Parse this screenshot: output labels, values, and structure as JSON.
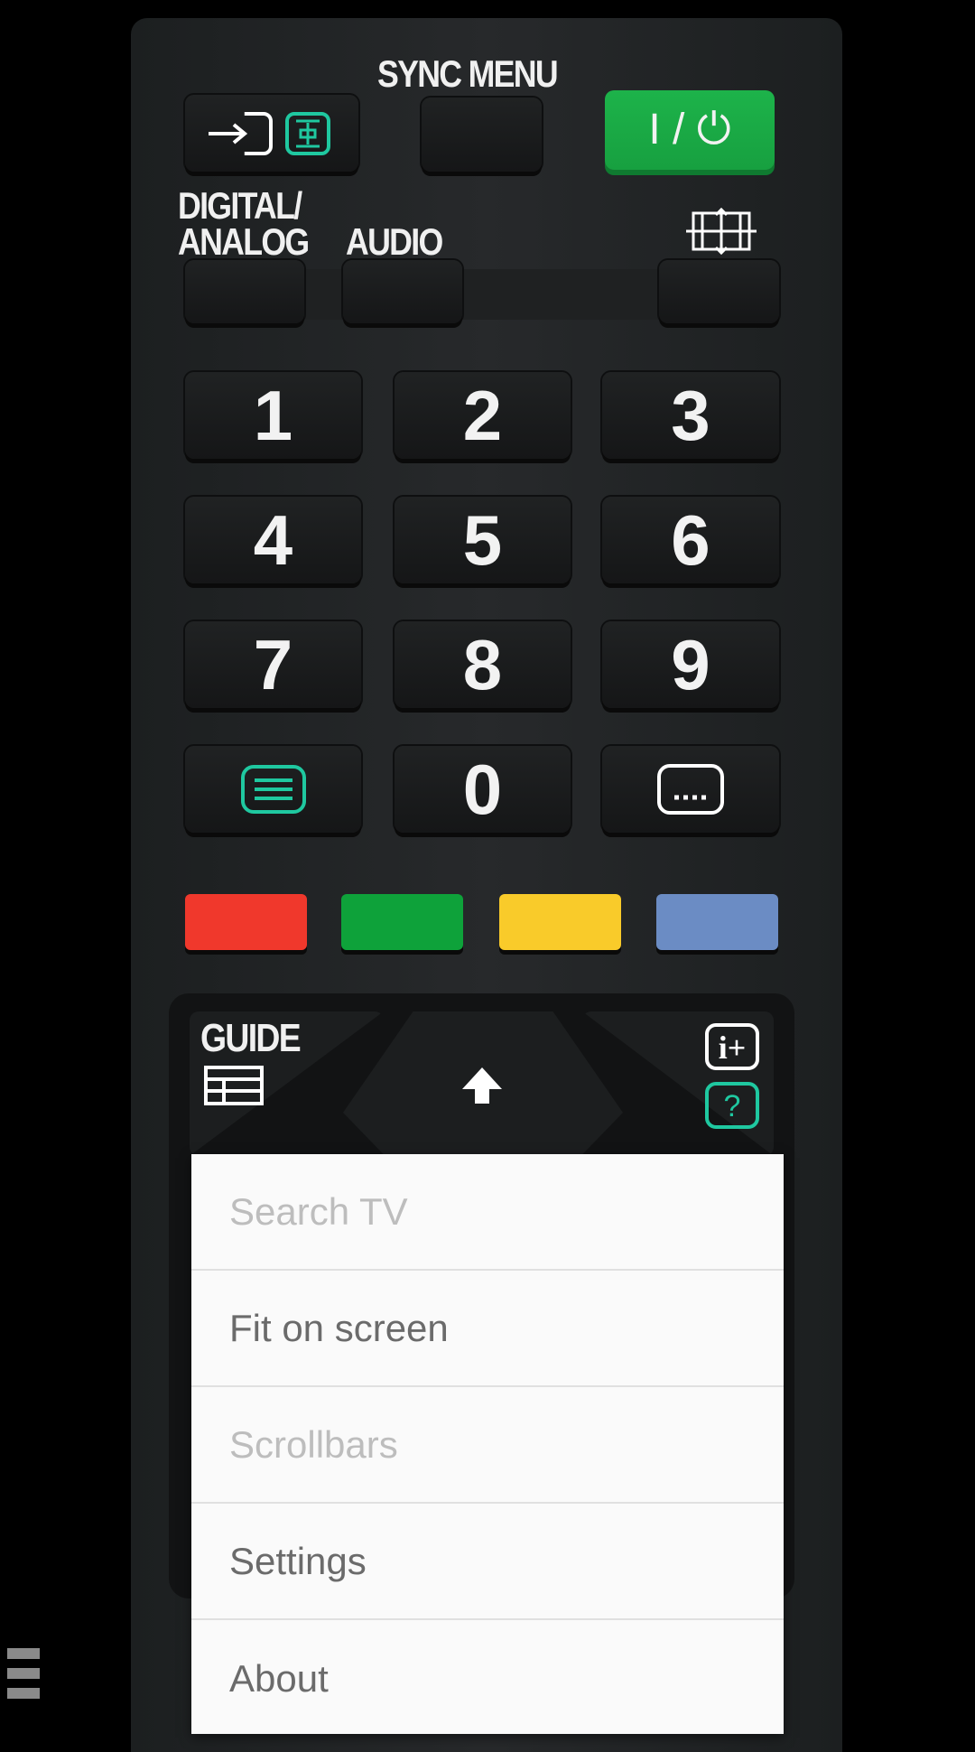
{
  "remote": {
    "sync_menu_label": "SYNC MENU",
    "power_label": "I / ⏻",
    "digital_analog_label": "DIGITAL/\nANALOG",
    "audio_label": "AUDIO",
    "numbers": [
      "1",
      "2",
      "3",
      "4",
      "5",
      "6",
      "7",
      "8",
      "9",
      "0"
    ],
    "color_buttons": [
      "#f0382c",
      "#0ea23a",
      "#f9cb2a",
      "#6b8cc4"
    ],
    "guide_label": "GUIDE",
    "accent": "#1fc8a0"
  },
  "menu": {
    "items": [
      {
        "label": "Search TV",
        "enabled": false
      },
      {
        "label": "Fit on screen",
        "enabled": true
      },
      {
        "label": "Scrollbars",
        "enabled": false
      },
      {
        "label": "Settings",
        "enabled": true
      },
      {
        "label": "About",
        "enabled": true
      }
    ]
  }
}
